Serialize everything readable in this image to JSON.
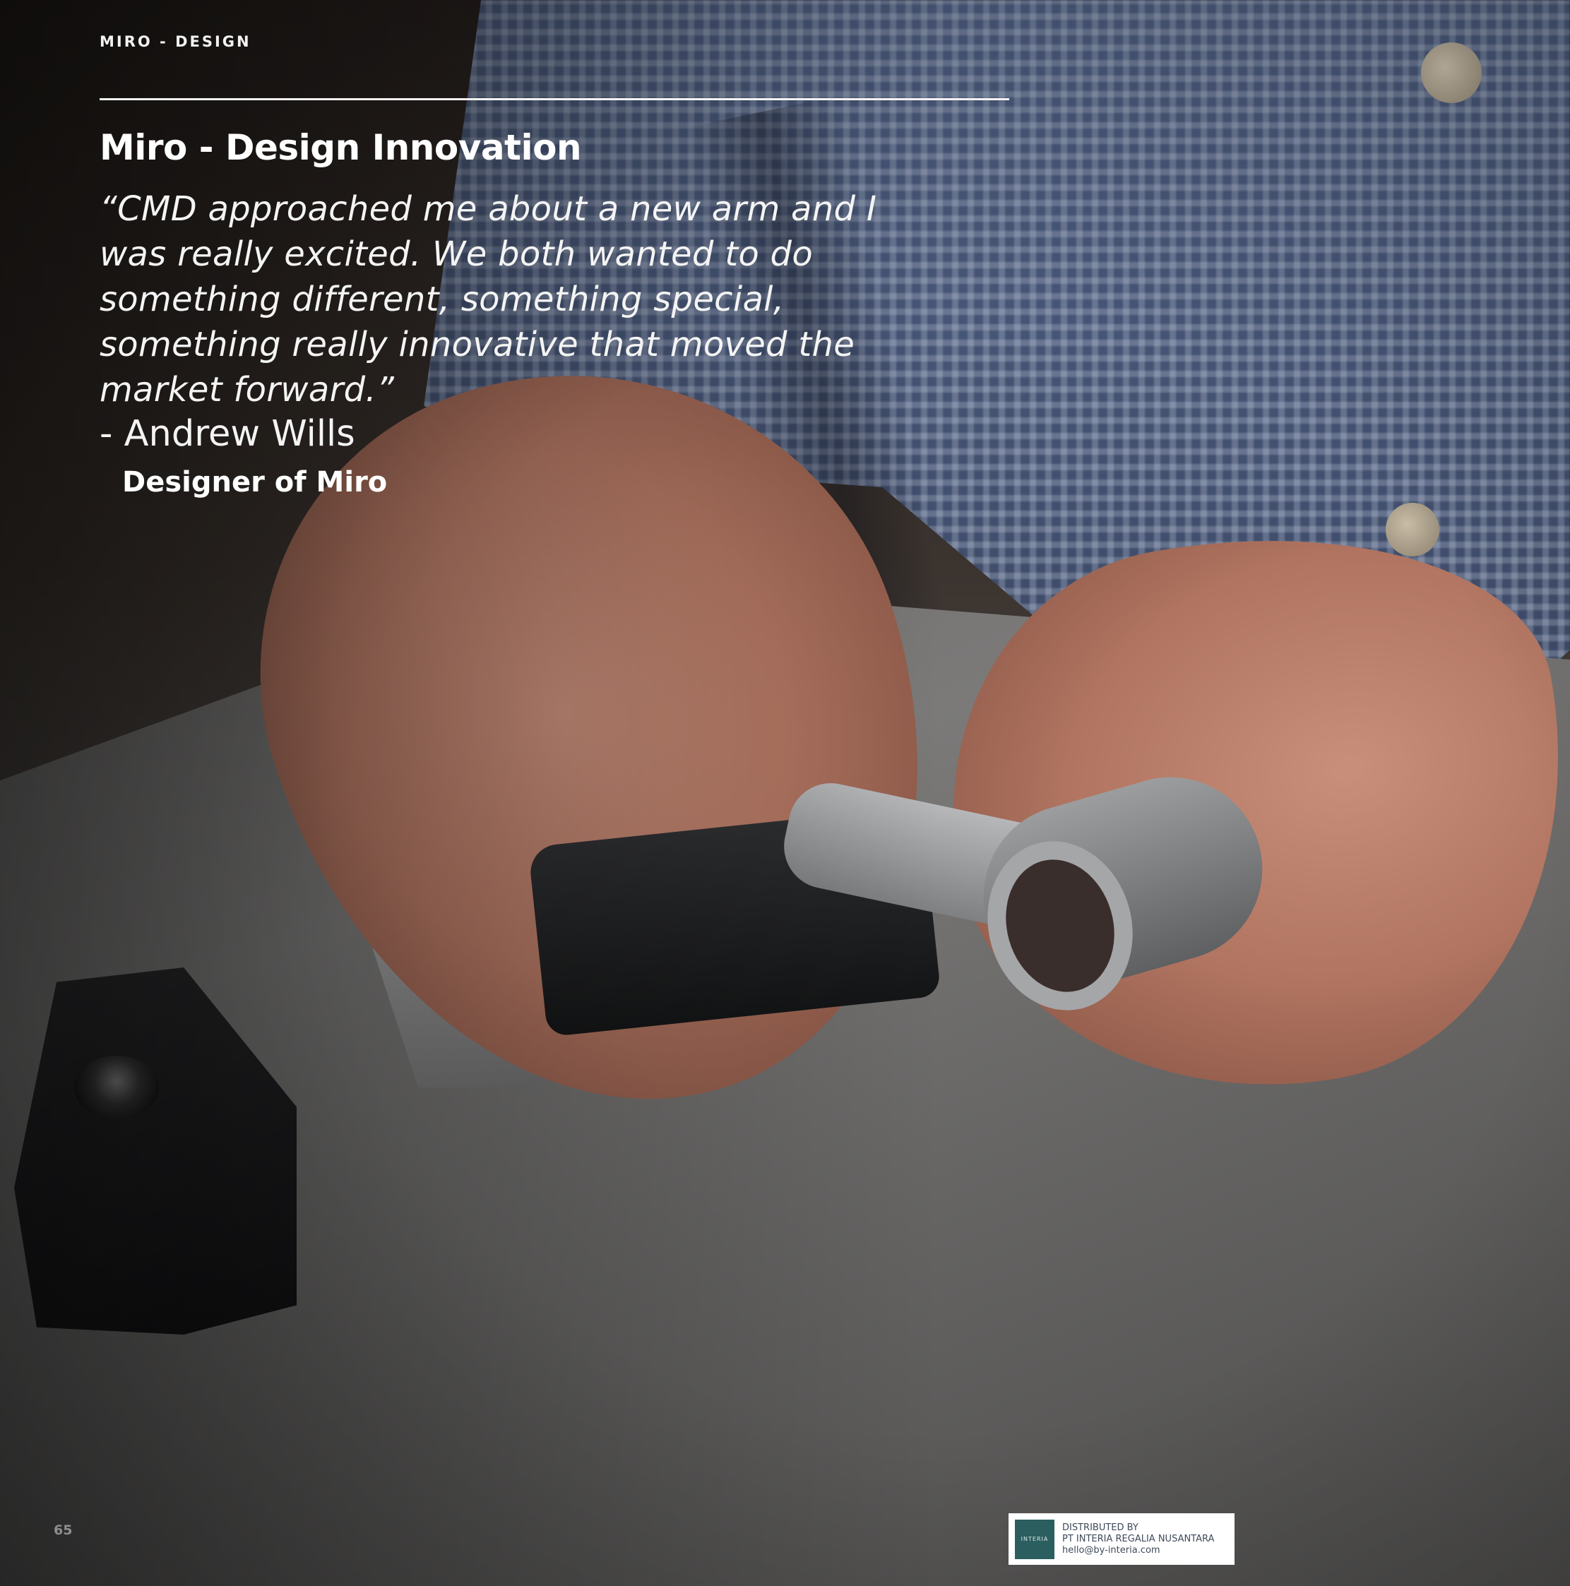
{
  "header": {
    "section_label": "MIRO - DESIGN"
  },
  "article": {
    "title": "Miro - Design Innovation",
    "quote": "“CMD approached me about a new arm and I was really excited. We both wanted to do something different, something special, something really innovative that moved the market forward.”",
    "author": "- Andrew Wills",
    "author_role": "Designer of Miro"
  },
  "footer": {
    "page_number": "65",
    "distributor": {
      "logo_text": "INTERIA",
      "line1": "DISTRIBUTED BY",
      "line2": "PT INTERIA REGALIA NUSANTARA",
      "line3": "hello@by-interia.com"
    }
  },
  "colors": {
    "logo_teal": "#2b5e5f",
    "text_white": "#ffffff"
  }
}
